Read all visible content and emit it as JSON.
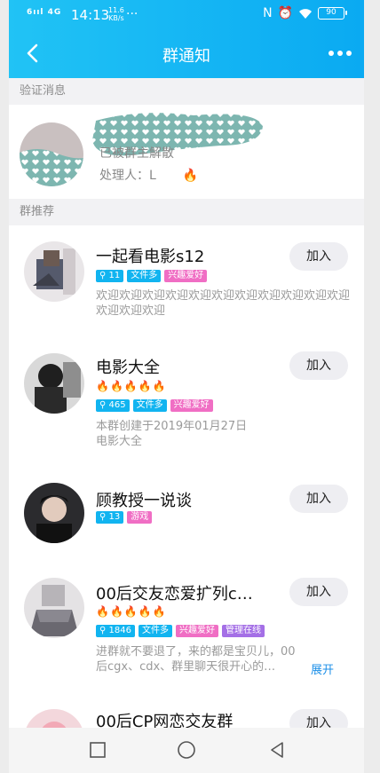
{
  "status": {
    "signal": "6",
    "network": "4G",
    "time": "14:13",
    "speed": "11.6",
    "speed_unit": "KB/s",
    "more": "···",
    "battery": "90"
  },
  "navbar": {
    "title": "群通知"
  },
  "sections": {
    "verify": "验证消息",
    "recommend": "群推荐"
  },
  "verify": {
    "status": "已被群主解散",
    "handler_label": "处理人：",
    "handler_name": "L"
  },
  "groups": [
    {
      "name": "一起看电影s12",
      "members": "11",
      "tags": [
        "文件多",
        "兴趣爱好"
      ],
      "fire": "",
      "desc": "欢迎欢迎欢迎欢迎欢迎欢迎欢迎欢迎欢迎欢迎欢迎欢迎欢迎欢迎",
      "join": "加入"
    },
    {
      "name": "电影大全",
      "members": "465",
      "tags": [
        "文件多",
        "兴趣爱好"
      ],
      "fire": "🔥🔥🔥🔥🔥",
      "desc": "本群创建于2019年01月27日\n电影大全",
      "join": "加入"
    },
    {
      "name": "顾教授一说谈",
      "members": "13",
      "tags": [
        "游戏"
      ],
      "fire": "",
      "desc": "",
      "join": "加入"
    },
    {
      "name": "00后交友恋爱扩列c…",
      "members": "1846",
      "tags": [
        "文件多",
        "兴趣爱好",
        "管理在线"
      ],
      "fire": "🔥🔥🔥🔥🔥",
      "desc": "进群就不要退了，来的都是宝贝儿，00后cgx、cdx、群里聊天很开心的…",
      "expand": "展开",
      "join": "加入"
    },
    {
      "name": "00后CP网恋交友群",
      "members": "",
      "tags": [],
      "fire": "",
      "desc": "",
      "join": "加入"
    }
  ],
  "colors": {
    "accent": "#11b4f0",
    "header_start": "#21c3f5",
    "header_end": "#0aaaf2",
    "tag_pink": "#f06ec4",
    "tag_purple": "#a46fe6",
    "link": "#1c8fe8"
  }
}
